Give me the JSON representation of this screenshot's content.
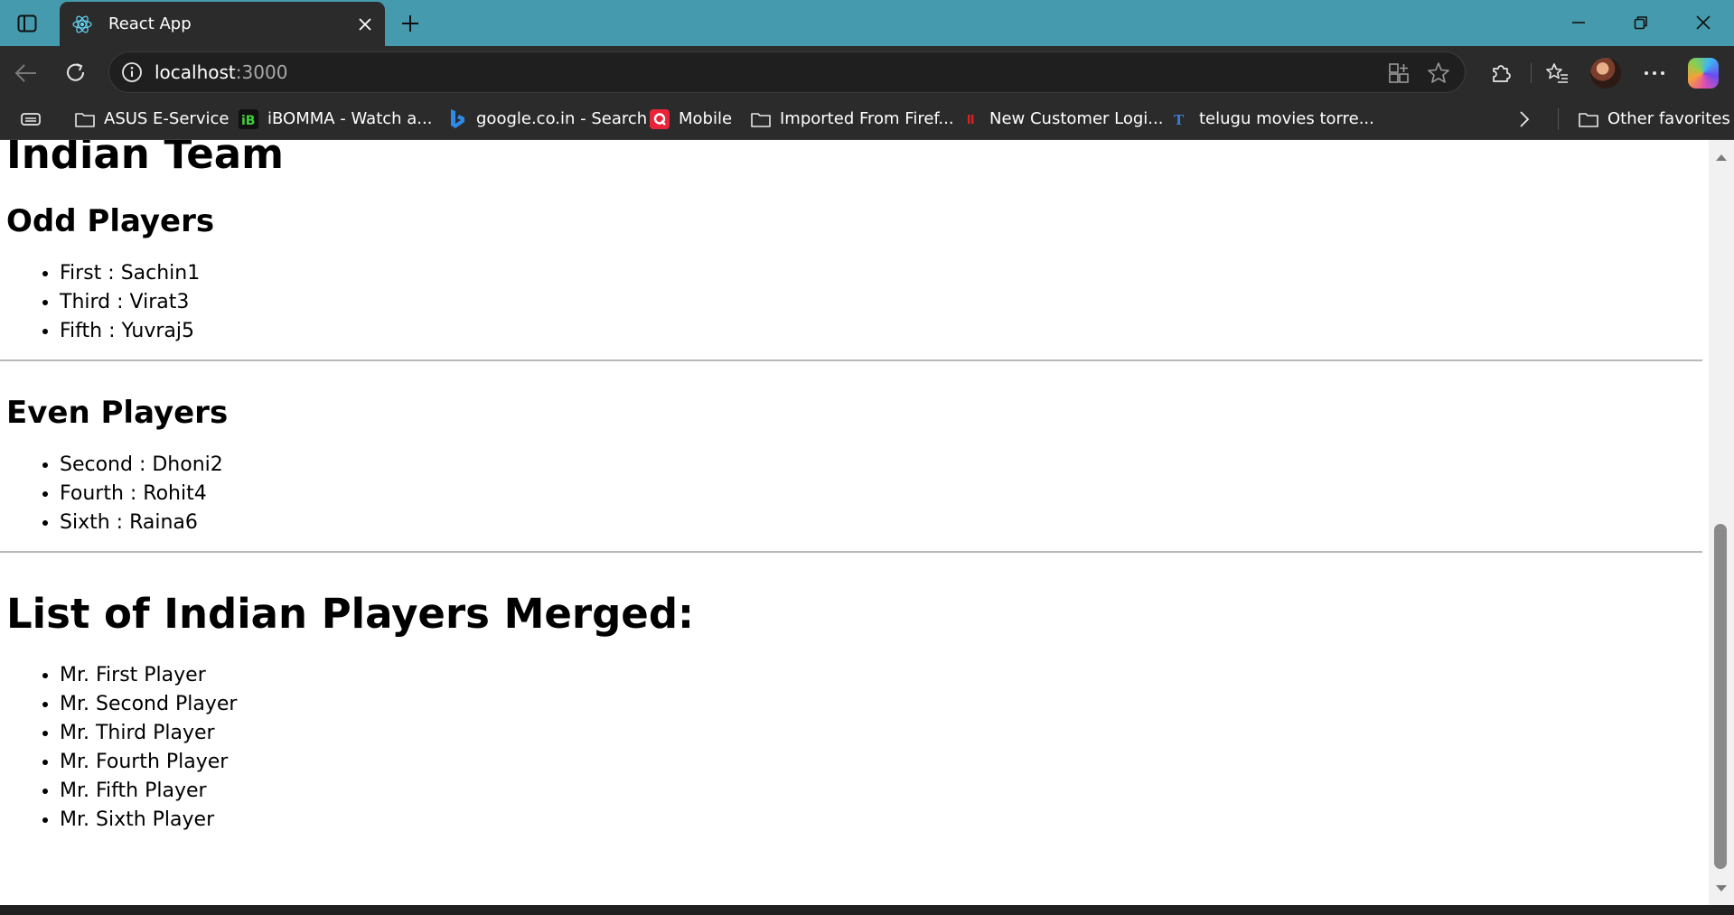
{
  "browser": {
    "tab_title": "React App",
    "url_host": "localhost",
    "url_port": ":3000",
    "accent_color": "#459bad"
  },
  "bookmarks": [
    {
      "label": "ASUS E-Service",
      "icon": "folder-icon"
    },
    {
      "label": "iBOMMA - Watch a...",
      "icon": "ibomma-icon"
    },
    {
      "label": "google.co.in - Search",
      "icon": "bing-icon"
    },
    {
      "label": "Mobile",
      "icon": "mobile-site-icon"
    },
    {
      "label": "Imported From Firef...",
      "icon": "folder-icon"
    },
    {
      "label": "New Customer Logi...",
      "icon": "customer-login-icon"
    },
    {
      "label": "telugu movies torre...",
      "icon": "torrent-site-icon"
    }
  ],
  "other_favorites": "Other favorites",
  "page": {
    "title": "Indian Team",
    "odd_heading": "Odd Players",
    "odd_players": [
      "First : Sachin1",
      "Third : Virat3",
      "Fifth : Yuvraj5"
    ],
    "even_heading": "Even Players",
    "even_players": [
      "Second : Dhoni2",
      "Fourth : Rohit4",
      "Sixth : Raina6"
    ],
    "merged_heading": "List of Indian Players Merged:",
    "merged_players": [
      "Mr. First Player",
      "Mr. Second Player",
      "Mr. Third Player",
      "Mr. Fourth Player",
      "Mr. Fifth Player",
      "Mr. Sixth Player"
    ]
  }
}
